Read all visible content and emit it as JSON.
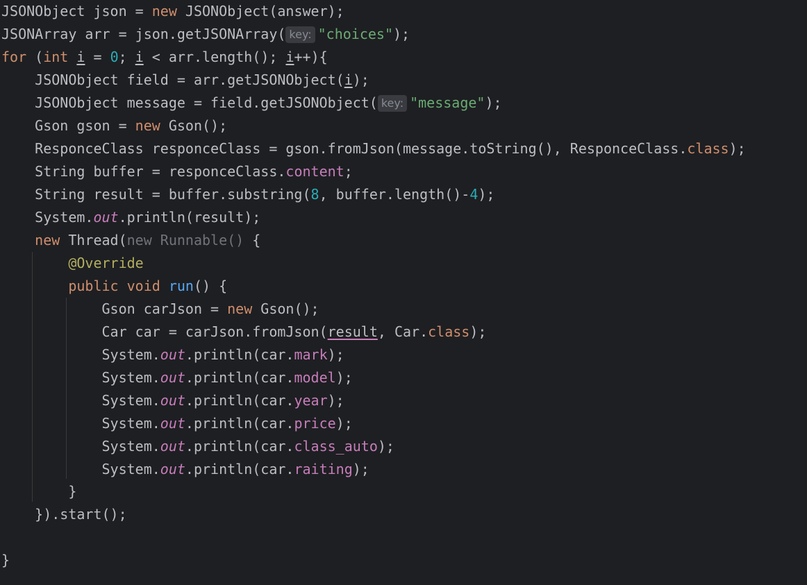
{
  "editor": {
    "lines": {
      "l01": {
        "t1": "JSONObject json = ",
        "kw1": "new",
        "t2": " JSONObject(answer);"
      },
      "l02": {
        "t1": "JSONArray arr = json.getJSONArray(",
        "hint": "key:",
        "str": "\"choices\"",
        "t2": ");"
      },
      "l03": {
        "kw1": "for",
        "t1": " (",
        "kw2": "int",
        "t2": " ",
        "var1": "i",
        "t3": " = ",
        "num1": "0",
        "t4": "; ",
        "var2": "i",
        "t5": " < arr.length(); ",
        "var3": "i",
        "t6": "++){"
      },
      "l04": {
        "t1": "    JSONObject field = arr.getJSONObject(",
        "var1": "i",
        "t2": ");"
      },
      "l05": {
        "t1": "    JSONObject message = field.getJSONObject(",
        "hint": "key:",
        "str": "\"message\"",
        "t2": ");"
      },
      "l06": {
        "t1": "    Gson gson = ",
        "kw1": "new",
        "t2": " Gson();"
      },
      "l07": {
        "t1": "    ResponceClass responceClass = gson.fromJson(message.toString(), ResponceClass.",
        "kw1": "class",
        "t2": ");"
      },
      "l08": {
        "t1": "    String buffer = responceClass.",
        "fld1": "content",
        "t2": ";"
      },
      "l09": {
        "t1": "    String result = buffer.substring(",
        "num1": "8",
        "t2": ", buffer.length()-",
        "num2": "4",
        "t3": ");"
      },
      "l10": {
        "t1": "    System.",
        "sfld": "out",
        "t2": ".println(result);"
      },
      "l11": {
        "t0": "    ",
        "kw1": "new",
        "t1": " Thread(",
        "dim1": "new Runnable()",
        "t2": " {"
      },
      "l12": {
        "t0": "        ",
        "ann1": "@Override"
      },
      "l13": {
        "t0": "        ",
        "kw1": "public",
        "t1": " ",
        "kw2": "void",
        "t2": " ",
        "fn1": "run",
        "t3": "() {"
      },
      "l14": {
        "t1": "            Gson carJson = ",
        "kw1": "new",
        "t2": " Gson();"
      },
      "l15": {
        "t1": "            Car car = carJson.fromJson(",
        "var1": "result",
        "t2": ", Car.",
        "kw1": "class",
        "t3": ");"
      },
      "l16": {
        "t1": "            System.",
        "sfld": "out",
        "t2": ".println(car.",
        "fld1": "mark",
        "t3": ");"
      },
      "l17": {
        "t1": "            System.",
        "sfld": "out",
        "t2": ".println(car.",
        "fld1": "model",
        "t3": ");"
      },
      "l18": {
        "t1": "            System.",
        "sfld": "out",
        "t2": ".println(car.",
        "fld1": "year",
        "t3": ");"
      },
      "l19": {
        "t1": "            System.",
        "sfld": "out",
        "t2": ".println(car.",
        "fld1": "price",
        "t3": ");"
      },
      "l20": {
        "t1": "            System.",
        "sfld": "out",
        "t2": ".println(car.",
        "fld1": "class_auto",
        "t3": ");"
      },
      "l21": {
        "t1": "            System.",
        "sfld": "out",
        "t2": ".println(car.",
        "fld1": "raiting",
        "t3": ");"
      },
      "l22": {
        "t1": "        }"
      },
      "l23": {
        "t1": "    }).start();"
      },
      "l24": {
        "t1": ""
      },
      "l25": {
        "t1": "}"
      }
    },
    "colors": {
      "background": "#1e1f22",
      "text": "#bcbec4",
      "keyword": "#cf8e6d",
      "string": "#6aab73",
      "number": "#2aacb8",
      "field": "#c77dbb",
      "annotation": "#b3ae60",
      "function": "#56a8f5",
      "dimmed": "#6f737a"
    }
  }
}
